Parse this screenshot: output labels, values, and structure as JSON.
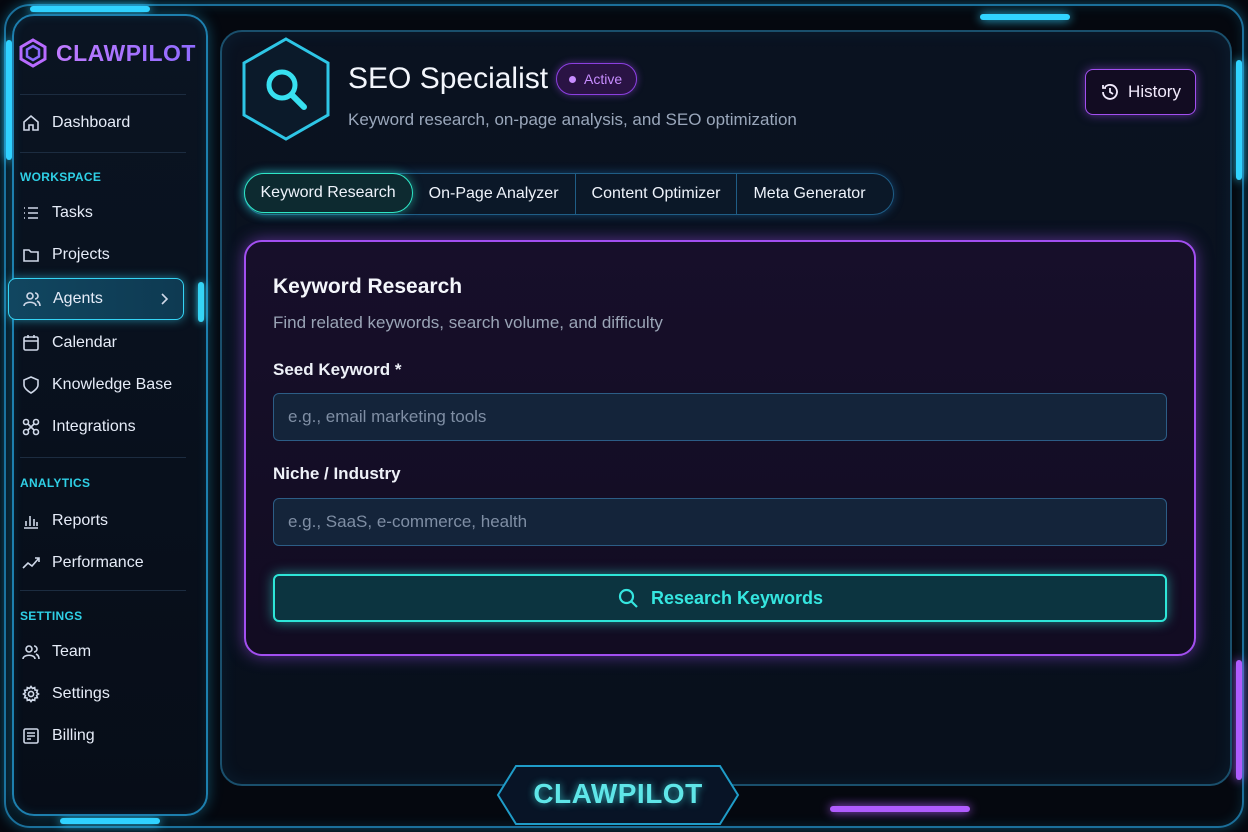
{
  "brand": {
    "name": "CLAWPILOT",
    "footer_name": "CLAWPILOT"
  },
  "sidebar": {
    "items": [
      {
        "label": "Dashboard",
        "icon": "home-icon"
      },
      {
        "label": "Tasks",
        "icon": "list-icon"
      },
      {
        "label": "Projects",
        "icon": "folder-icon"
      },
      {
        "label": "Agents",
        "icon": "users-icon"
      },
      {
        "label": "Calendar",
        "icon": "calendar-icon"
      },
      {
        "label": "Knowledge Base",
        "icon": "shield-icon"
      },
      {
        "label": "Integrations",
        "icon": "integrations-icon"
      },
      {
        "label": "Reports",
        "icon": "bar-chart-icon"
      },
      {
        "label": "Performance",
        "icon": "trend-icon"
      },
      {
        "label": "Team",
        "icon": "team-icon"
      },
      {
        "label": "Settings",
        "icon": "gear-icon"
      },
      {
        "label": "Billing",
        "icon": "billing-icon"
      }
    ],
    "sections": {
      "workspace": "WORKSPACE",
      "analytics": "ANALYTICS",
      "settings": "SETTINGS"
    }
  },
  "header": {
    "title": "SEO Specialist",
    "status": "Active",
    "subtitle": "Keyword research, on-page analysis, and SEO optimization",
    "history_label": "History"
  },
  "tabs": [
    {
      "label": "Keyword Research"
    },
    {
      "label": "On-Page Analyzer"
    },
    {
      "label": "Content Optimizer"
    },
    {
      "label": "Meta Generator"
    }
  ],
  "form": {
    "title": "Keyword Research",
    "subtitle": "Find related keywords, search volume, and difficulty",
    "seed": {
      "label": "Seed Keyword *",
      "placeholder": "e.g., email marketing tools",
      "value": ""
    },
    "niche": {
      "label": "Niche / Industry",
      "placeholder": "e.g., SaaS, e-commerce, health",
      "value": ""
    },
    "submit_label": "Research Keywords"
  },
  "colors": {
    "accent_cyan": "#35d4f5",
    "accent_purple": "#a24ff0",
    "accent_teal": "#2ee6d8"
  }
}
